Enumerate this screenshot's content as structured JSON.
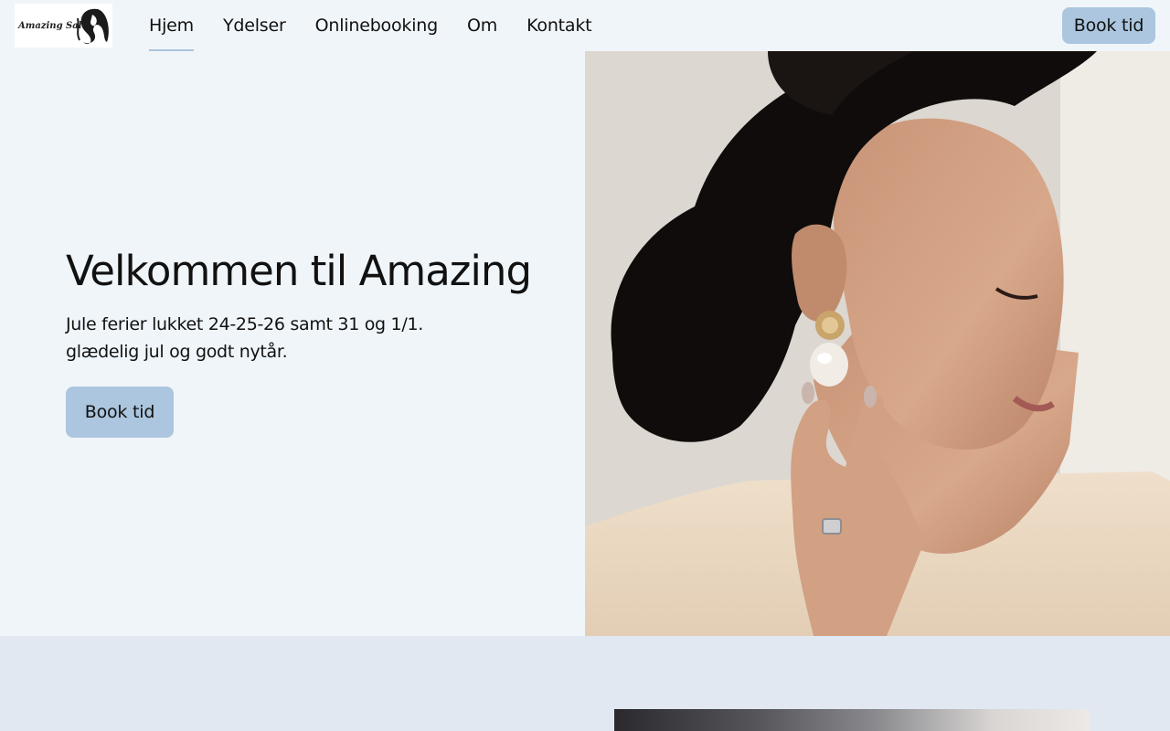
{
  "logo": {
    "text": "Amazing Salon",
    "icon": "woman-hair-logo-icon"
  },
  "nav": {
    "items": [
      {
        "label": "Hjem",
        "active": true
      },
      {
        "label": "Ydelser",
        "active": false
      },
      {
        "label": "Onlinebooking",
        "active": false
      },
      {
        "label": "Om",
        "active": false
      },
      {
        "label": "Kontakt",
        "active": false
      }
    ],
    "book_label": "Book tid"
  },
  "hero": {
    "title": "Velkommen til Amazing",
    "text": "Jule ferier lukket 24-25-26 samt 31 og 1/1. glædelig jul og godt nytår.",
    "book_label": "Book tid",
    "image": "woman-with-earring-photo"
  },
  "lower": {
    "image": "salon-photo"
  },
  "colors": {
    "background": "#f0f5fa",
    "accent_button": "#abc6de",
    "lower_background": "#e1e8f1",
    "text": "#111111"
  }
}
